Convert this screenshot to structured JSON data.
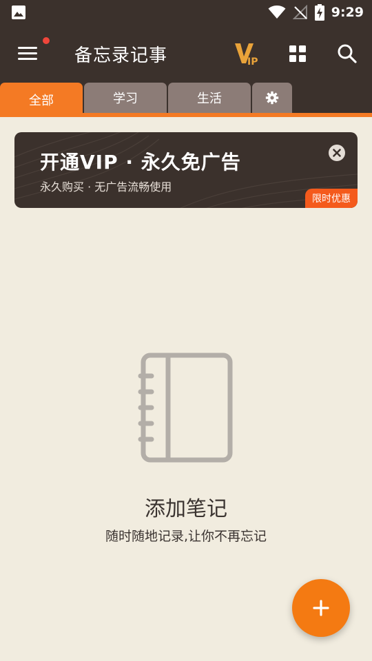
{
  "status_bar": {
    "time": "9:29",
    "icons": [
      "image-icon",
      "wifi-icon",
      "no-signal-icon",
      "battery-charging-icon"
    ]
  },
  "app_bar": {
    "title": "备忘录记事",
    "has_notification_dot": true,
    "icons": [
      "menu-icon",
      "vip-icon",
      "grid-view-icon",
      "search-icon"
    ]
  },
  "tabs": [
    {
      "label": "全部",
      "active": true
    },
    {
      "label": "学习",
      "active": false
    },
    {
      "label": "生活",
      "active": false
    },
    {
      "label": "",
      "icon": "gear-icon",
      "active": false
    }
  ],
  "banner": {
    "title": "开通VIP · 永久免广告",
    "subtitle": "永久购买 · 无广告流畅使用",
    "badge": "限时优惠",
    "close_icon": "close-circle-icon"
  },
  "empty_state": {
    "icon": "notebook-icon",
    "title": "添加笔记",
    "subtitle": "随时随地记录,让你不再忘记"
  },
  "fab": {
    "icon": "plus-icon"
  },
  "colors": {
    "header_bg": "#3b312c",
    "accent": "#f47a24",
    "page_bg": "#f1ecdf",
    "tab_inactive": "#8c7c77",
    "badge": "#f45a1c",
    "vip_gold": "#e9a33a"
  }
}
